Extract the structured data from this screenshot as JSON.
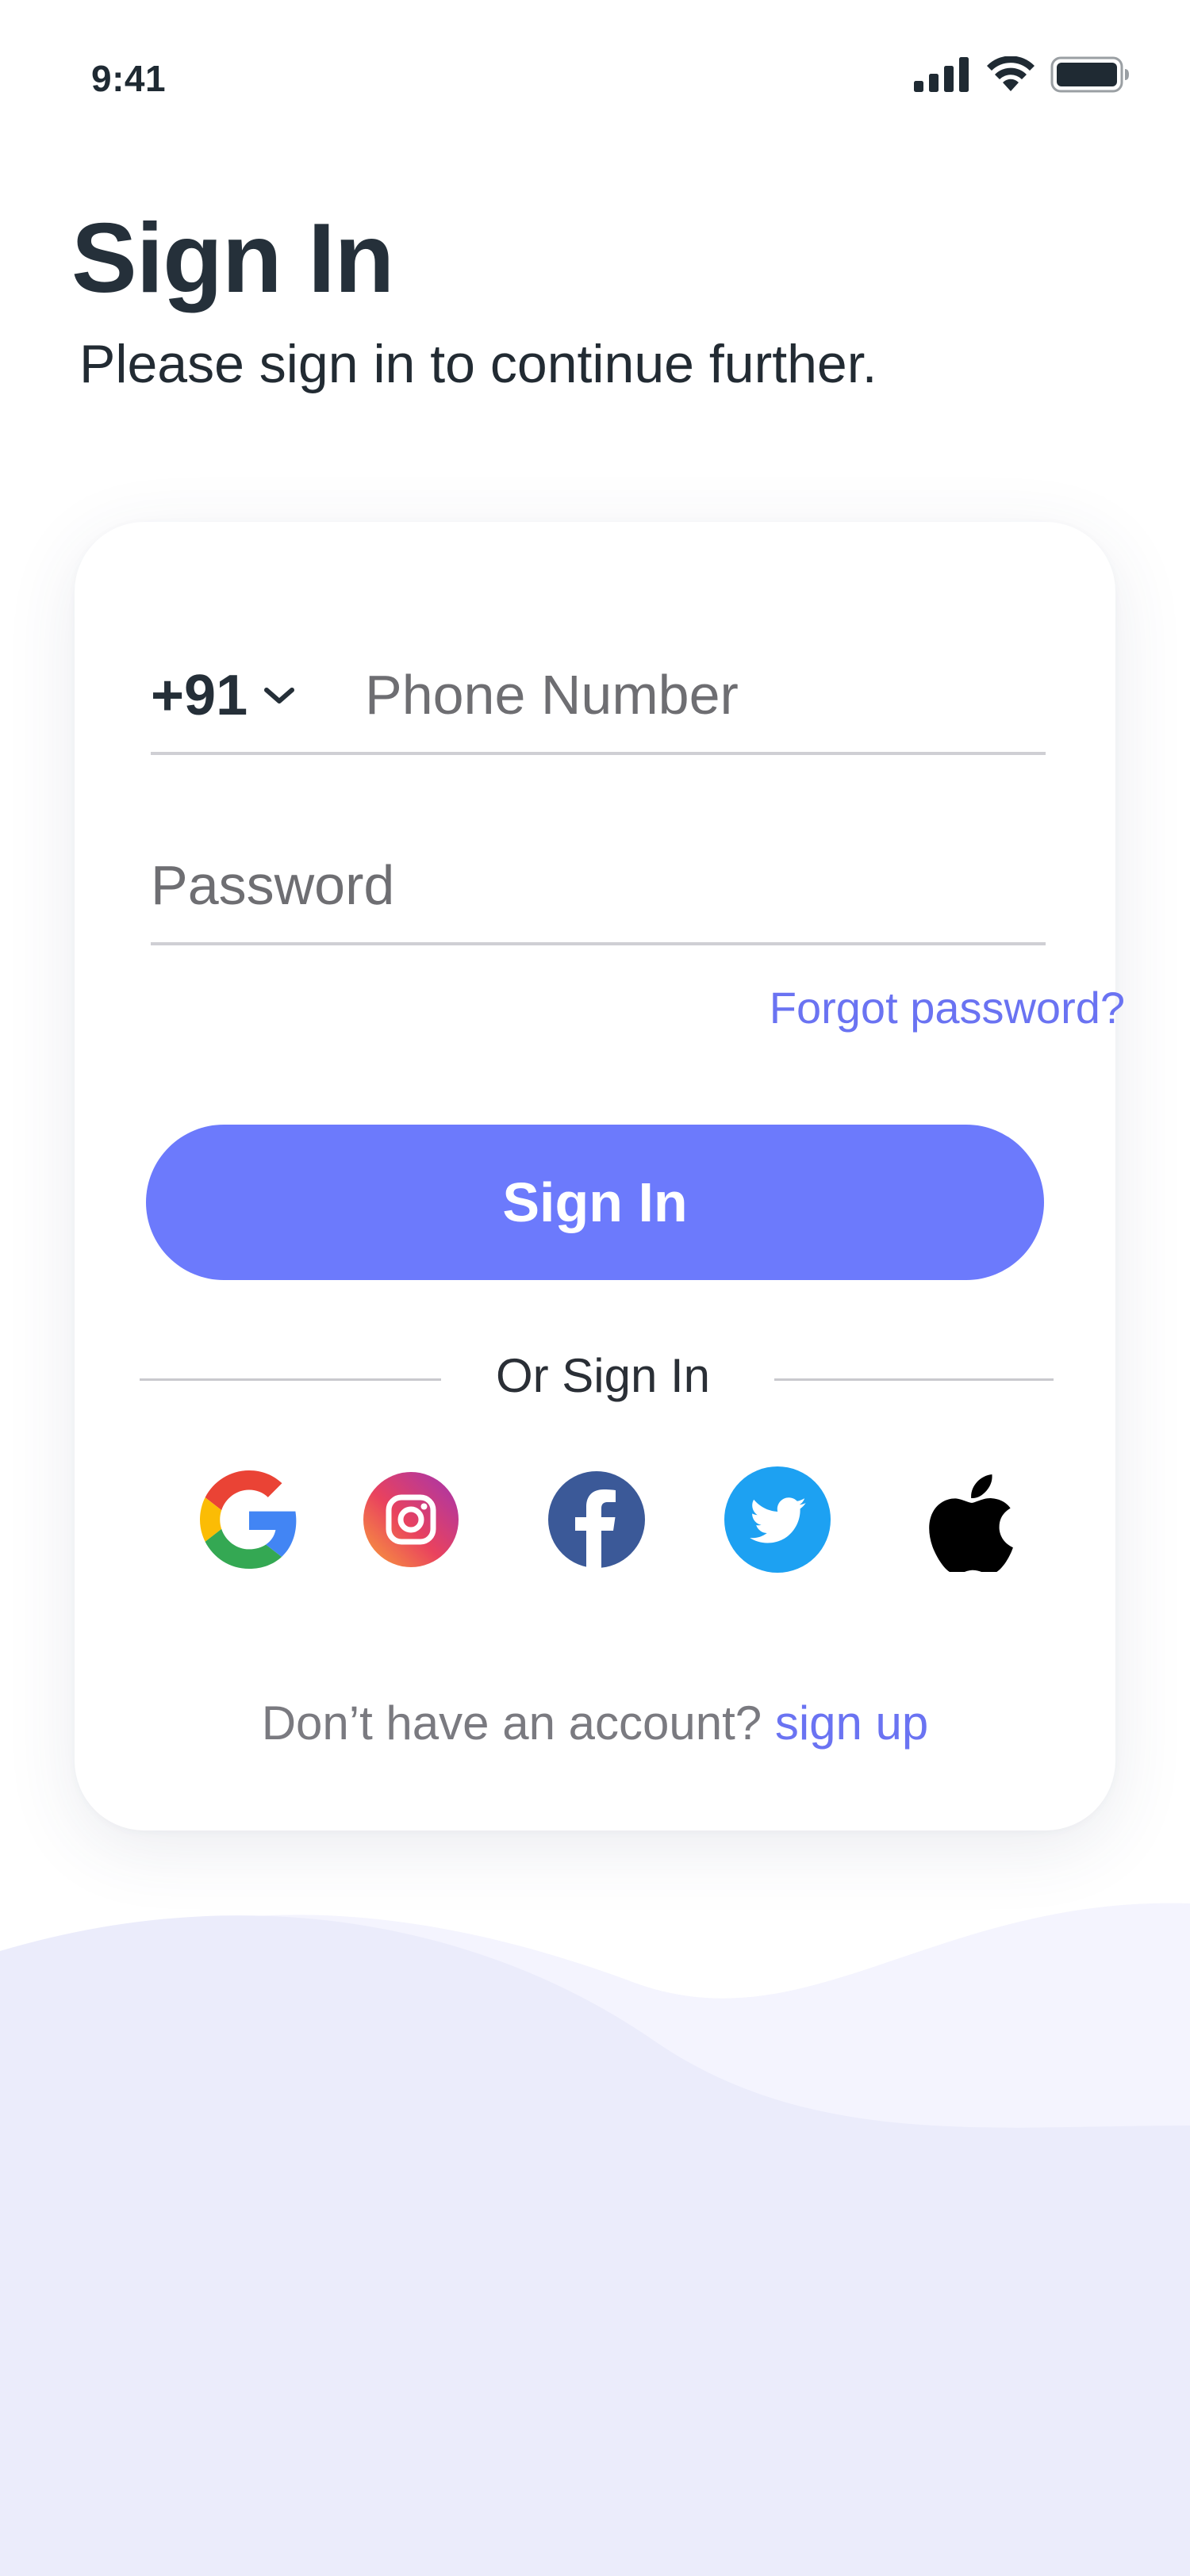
{
  "status_bar": {
    "time": "9:41"
  },
  "header": {
    "title": "Sign In",
    "subtitle": "Please sign in to continue further."
  },
  "form": {
    "country_code": "+91",
    "phone_placeholder": "Phone Number",
    "password_placeholder": "Password",
    "forgot_password_label": "Forgot password?",
    "submit_label": "Sign In"
  },
  "social": {
    "divider_label": "Or Sign In",
    "providers": [
      "google",
      "instagram",
      "facebook",
      "twitter",
      "apple"
    ]
  },
  "footer": {
    "prompt": "Don’t have an account?",
    "signup_label": "sign up"
  },
  "colors": {
    "accent": "#6c7afc",
    "link": "#6a73f2",
    "title": "#25303a",
    "wave_light": "#f4f4fe",
    "wave_dark": "#ebecfb"
  }
}
